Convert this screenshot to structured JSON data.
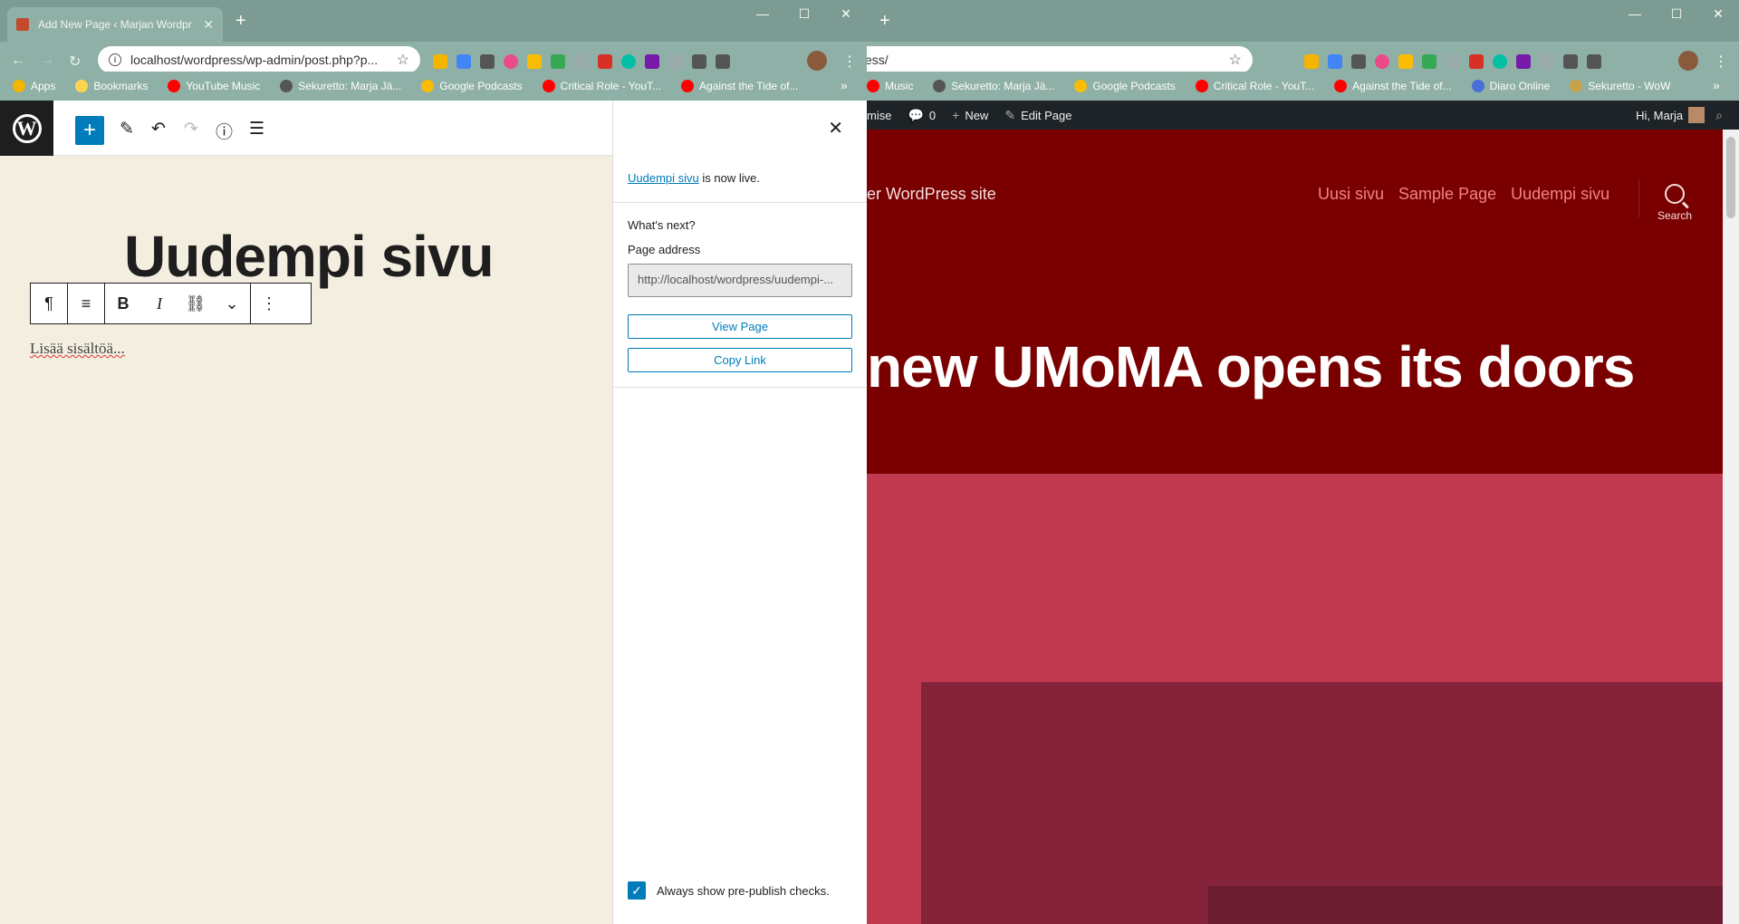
{
  "left_window": {
    "tab_title": "Add New Page ‹ Marjan Wordpr",
    "url": "localhost/wordpress/wp-admin/post.php?p...",
    "bookmarks": [
      {
        "label": "Apps",
        "color": "#f4b400"
      },
      {
        "label": "Bookmarks",
        "color": "#ffd54f"
      },
      {
        "label": "YouTube Music",
        "color": "#ff0000"
      },
      {
        "label": "Sekuretto: Marja Jä...",
        "color": "#555555"
      },
      {
        "label": "Google Podcasts",
        "color": "#fbbc04"
      },
      {
        "label": "Critical Role - YouT...",
        "color": "#ff0000"
      },
      {
        "label": "Against the Tide of...",
        "color": "#ff0000"
      }
    ],
    "more": "»"
  },
  "right_window": {
    "url": "ess/",
    "bookmarks": [
      {
        "label": "Music",
        "color": "#ff0000"
      },
      {
        "label": "Sekuretto: Marja Jä...",
        "color": "#555555"
      },
      {
        "label": "Google Podcasts",
        "color": "#fbbc04"
      },
      {
        "label": "Critical Role - YouT...",
        "color": "#ff0000"
      },
      {
        "label": "Against the Tide of...",
        "color": "#ff0000"
      },
      {
        "label": "Diaro Online",
        "color": "#4a6fd6"
      },
      {
        "label": "Sekuretto - WoW",
        "color": "#c8a24a"
      }
    ],
    "more": "»"
  },
  "editor": {
    "page_title": "Uudempi sivu",
    "paragraph_placeholder": "Lisää sisältöä..."
  },
  "publish_panel": {
    "live_link": "Uudempi sivu",
    "live_suffix": " is now live.",
    "whats_next": "What's next?",
    "address_label": "Page address",
    "address_value": "http://localhost/wordpress/uudempi-...",
    "view_page": "View Page",
    "copy_link": "Copy Link",
    "always_show": "Always show pre-publish checks."
  },
  "site": {
    "adminbar": {
      "customise": "mise",
      "comments": "0",
      "new": "New",
      "edit_page": "Edit Page",
      "greeting": "Hi, Marja"
    },
    "description": "er WordPress site",
    "nav": [
      "Uusi sivu",
      "Sample Page",
      "Uudempi sivu"
    ],
    "search_label": "Search",
    "hero_title": "new UMoMA opens its doors"
  },
  "colors": {
    "wp_blue": "#007cba",
    "site_header": "#7a0000",
    "site_pink": "#c0394f",
    "nav_link": "#f08484"
  }
}
